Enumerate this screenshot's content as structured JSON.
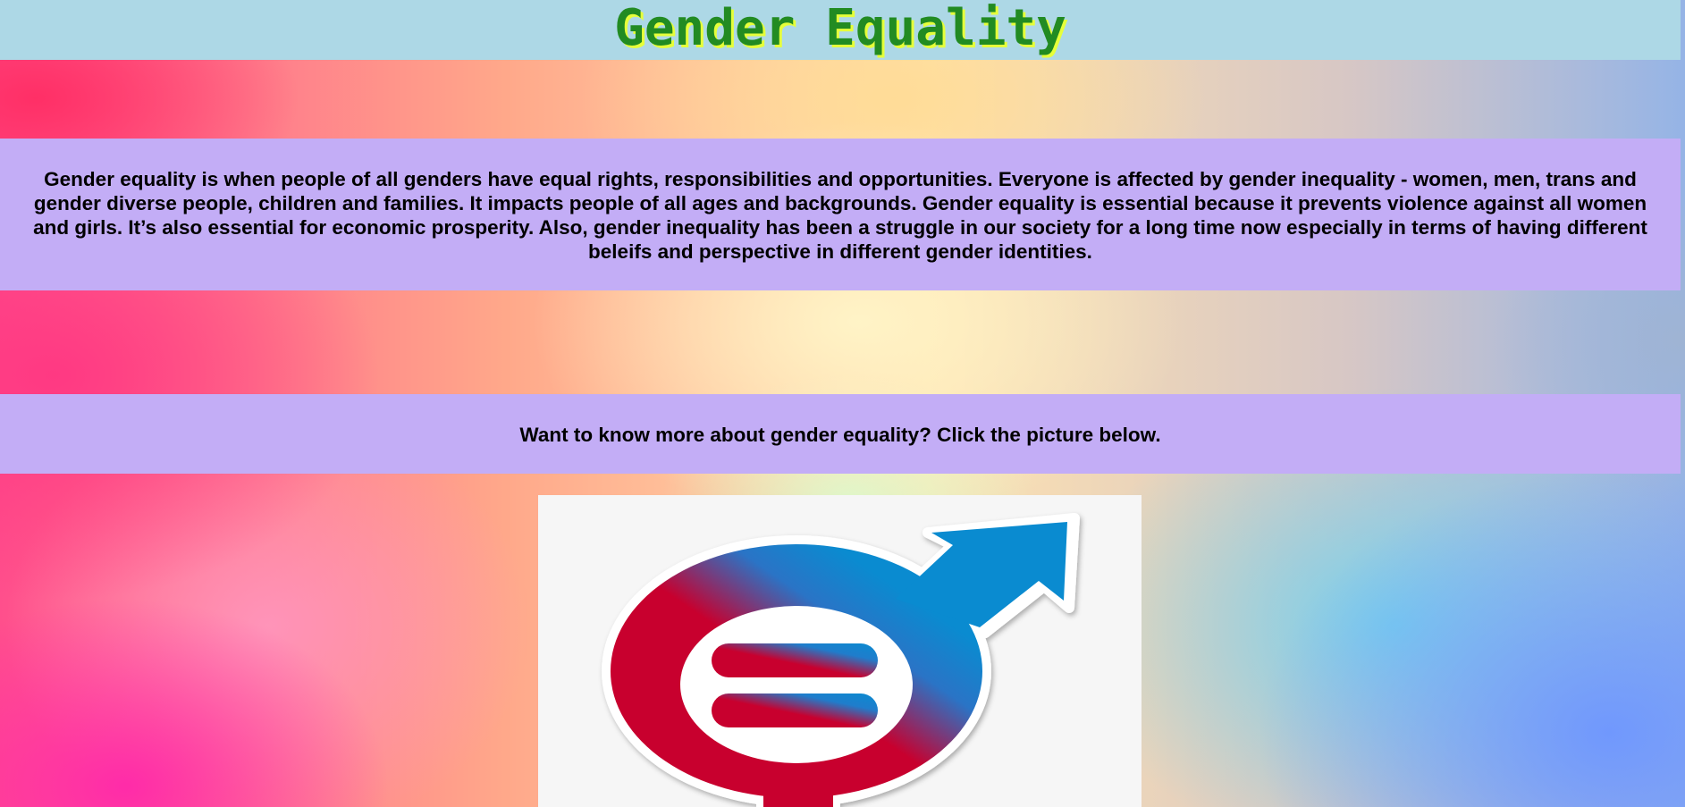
{
  "header": {
    "title": "Gender Equality"
  },
  "intro": {
    "text": "Gender equality is when people of all genders have equal rights, responsibilities and opportunities. Everyone is affected by gender inequality - women, men, trans and gender diverse people, children and families. It impacts people of all ages and backgrounds. Gender equality is essential because it prevents violence against all women and girls. It’s also essential for economic prosperity. Also, gender inequality has been a struggle in our society for a long time now especially in terms of having different beleifs and perspective in different gender identities."
  },
  "cta": {
    "text": "Want to know more about gender equality? Click the picture below."
  },
  "picture": {
    "icon": "gender-equality-symbol-icon"
  },
  "colors": {
    "header_bg": "#add8e6",
    "title": "#228b22",
    "title_shadow": "#e6ff3a",
    "panel_bg": "#c3adf6",
    "symbol_red": "#c8002e",
    "symbol_blue": "#0a8bd0"
  }
}
